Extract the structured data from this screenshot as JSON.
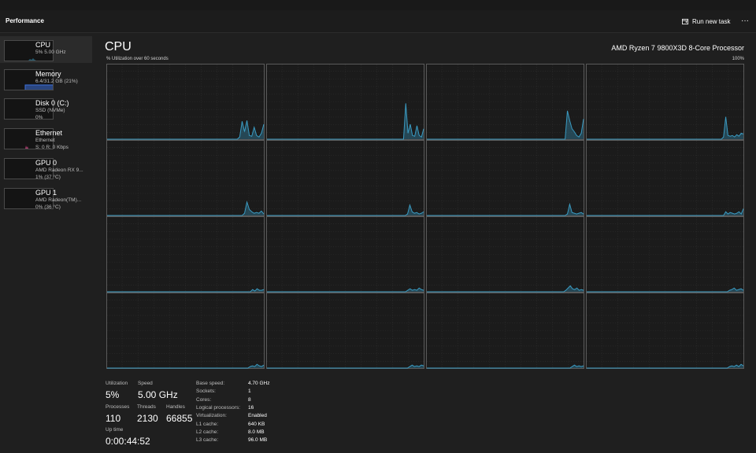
{
  "header": {
    "title": "Performance",
    "run_task_label": "Run new task",
    "more_label": "···"
  },
  "nav": [
    {
      "name": "CPU",
      "sub1": "5%  5.00 GHz",
      "sub2": ""
    },
    {
      "name": "Memory",
      "sub1": "6.4/31.2 GB (21%)",
      "sub2": ""
    },
    {
      "name": "Disk 0 (C:)",
      "sub1": "SSD (NVMe)",
      "sub2": "0%"
    },
    {
      "name": "Ethernet",
      "sub1": "Ethernet",
      "sub2": "S: 0 R: 0 Kbps"
    },
    {
      "name": "GPU 0",
      "sub1": "AMD Radeon RX 9...",
      "sub2": "1% (37 °C)"
    },
    {
      "name": "GPU 1",
      "sub1": "AMD Radeon(TM)...",
      "sub2": "0% (36 °C)"
    }
  ],
  "main": {
    "title": "CPU",
    "processor": "AMD Ryzen 7 9800X3D 8-Core Processor",
    "caption": "% Utilization over 60 seconds",
    "max_label": "100%"
  },
  "colors": {
    "accent": "#3a9bc2",
    "memory": "#3d6fd8",
    "ethernet": "#c4437d"
  },
  "chart_data": {
    "type": "area",
    "y_range": [
      0,
      100
    ],
    "series": [
      {
        "values": [
          0,
          0,
          0,
          0,
          0,
          0,
          0,
          0,
          0,
          0,
          0,
          0,
          0,
          0,
          0,
          0,
          0,
          0,
          0,
          0,
          0,
          0,
          0,
          0,
          0,
          0,
          0,
          0,
          0,
          0,
          0,
          0,
          0,
          0,
          0,
          0,
          0,
          0,
          0,
          0,
          0,
          0,
          0,
          0,
          0,
          0,
          0,
          0,
          0,
          0,
          0,
          0,
          0,
          0,
          0,
          3,
          24,
          10,
          25,
          5,
          4,
          16,
          5,
          3,
          8,
          20
        ]
      },
      {
        "values": [
          0,
          0,
          0,
          0,
          0,
          0,
          0,
          0,
          0,
          0,
          0,
          0,
          0,
          0,
          0,
          0,
          0,
          0,
          0,
          0,
          0,
          0,
          0,
          0,
          0,
          0,
          0,
          0,
          0,
          0,
          0,
          0,
          0,
          0,
          0,
          0,
          0,
          0,
          0,
          0,
          0,
          0,
          0,
          0,
          0,
          0,
          0,
          0,
          0,
          0,
          0,
          0,
          0,
          0,
          0,
          0,
          0,
          0,
          0,
          0,
          0,
          0,
          48,
          8,
          20,
          5,
          4,
          18,
          5,
          3,
          14
        ]
      },
      {
        "values": [
          0,
          0,
          0,
          0,
          0,
          0,
          0,
          0,
          0,
          0,
          0,
          0,
          0,
          0,
          0,
          0,
          0,
          0,
          0,
          0,
          0,
          0,
          0,
          0,
          0,
          0,
          0,
          0,
          0,
          0,
          0,
          0,
          0,
          0,
          0,
          0,
          0,
          0,
          0,
          0,
          0,
          0,
          0,
          0,
          0,
          0,
          0,
          0,
          0,
          0,
          0,
          0,
          0,
          0,
          0,
          0,
          0,
          0,
          0,
          0,
          0,
          38,
          25,
          14,
          10,
          5,
          3,
          8,
          27
        ]
      },
      {
        "values": [
          0,
          0,
          0,
          0,
          0,
          0,
          0,
          0,
          0,
          0,
          0,
          0,
          0,
          0,
          0,
          0,
          0,
          0,
          0,
          0,
          0,
          0,
          0,
          0,
          0,
          0,
          0,
          0,
          0,
          0,
          0,
          0,
          0,
          0,
          0,
          0,
          0,
          0,
          0,
          0,
          0,
          0,
          0,
          0,
          0,
          0,
          0,
          0,
          0,
          0,
          0,
          0,
          0,
          0,
          0,
          0,
          0,
          0,
          0,
          0,
          0,
          0,
          3,
          30,
          5,
          4,
          5,
          3,
          6,
          4,
          8,
          7
        ]
      },
      {
        "values": [
          0,
          0,
          0,
          0,
          0,
          0,
          0,
          0,
          0,
          0,
          0,
          0,
          0,
          0,
          0,
          0,
          0,
          0,
          0,
          0,
          0,
          0,
          0,
          0,
          0,
          0,
          0,
          0,
          0,
          0,
          0,
          0,
          0,
          0,
          0,
          0,
          0,
          0,
          0,
          0,
          0,
          0,
          0,
          0,
          0,
          0,
          0,
          0,
          0,
          0,
          0,
          0,
          0,
          0,
          0,
          0,
          0,
          3,
          18,
          8,
          5,
          3,
          4,
          3,
          6,
          2
        ]
      },
      {
        "values": [
          0,
          0,
          0,
          0,
          0,
          0,
          0,
          0,
          0,
          0,
          0,
          0,
          0,
          0,
          0,
          0,
          0,
          0,
          0,
          0,
          0,
          0,
          0,
          0,
          0,
          0,
          0,
          0,
          0,
          0,
          0,
          0,
          0,
          0,
          0,
          0,
          0,
          0,
          0,
          0,
          0,
          0,
          0,
          0,
          0,
          0,
          0,
          0,
          0,
          0,
          0,
          0,
          0,
          0,
          0,
          0,
          0,
          0,
          0,
          0,
          0,
          2,
          14,
          5,
          3,
          4,
          2,
          3,
          5
        ]
      },
      {
        "values": [
          0,
          0,
          0,
          0,
          0,
          0,
          0,
          0,
          0,
          0,
          0,
          0,
          0,
          0,
          0,
          0,
          0,
          0,
          0,
          0,
          0,
          0,
          0,
          0,
          0,
          0,
          0,
          0,
          0,
          0,
          0,
          0,
          0,
          0,
          0,
          0,
          0,
          0,
          0,
          0,
          0,
          0,
          0,
          0,
          0,
          0,
          0,
          0,
          0,
          0,
          0,
          0,
          0,
          0,
          0,
          0,
          0,
          0,
          0,
          0,
          0,
          2,
          15,
          4,
          3,
          2,
          3,
          4,
          2
        ]
      },
      {
        "values": [
          0,
          0,
          0,
          0,
          0,
          0,
          0,
          0,
          0,
          0,
          0,
          0,
          0,
          0,
          0,
          0,
          0,
          0,
          0,
          0,
          0,
          0,
          0,
          0,
          0,
          0,
          0,
          0,
          0,
          0,
          0,
          0,
          0,
          0,
          0,
          0,
          0,
          0,
          0,
          0,
          0,
          0,
          0,
          0,
          0,
          0,
          0,
          0,
          0,
          0,
          0,
          0,
          0,
          0,
          0,
          0,
          0,
          0,
          0,
          0,
          0,
          0,
          0,
          5,
          2,
          4,
          3,
          2,
          3,
          5,
          2,
          9
        ]
      },
      {
        "values": [
          0,
          0,
          0,
          0,
          0,
          0,
          0,
          0,
          0,
          0,
          0,
          0,
          0,
          0,
          0,
          0,
          0,
          0,
          0,
          0,
          0,
          0,
          0,
          0,
          0,
          0,
          0,
          0,
          0,
          0,
          0,
          0,
          0,
          0,
          0,
          0,
          0,
          0,
          0,
          0,
          0,
          0,
          0,
          0,
          0,
          0,
          0,
          0,
          0,
          0,
          0,
          0,
          0,
          0,
          0,
          0,
          0,
          0,
          0,
          0,
          0,
          0,
          0,
          0,
          0,
          3,
          1,
          4,
          2,
          2,
          3
        ]
      },
      {
        "values": [
          0,
          0,
          0,
          0,
          0,
          0,
          0,
          0,
          0,
          0,
          0,
          0,
          0,
          0,
          0,
          0,
          0,
          0,
          0,
          0,
          0,
          0,
          0,
          0,
          0,
          0,
          0,
          0,
          0,
          0,
          0,
          0,
          0,
          0,
          0,
          0,
          0,
          0,
          0,
          0,
          0,
          0,
          0,
          0,
          0,
          0,
          0,
          0,
          0,
          0,
          0,
          0,
          0,
          0,
          0,
          0,
          0,
          0,
          0,
          0,
          0,
          0,
          2,
          4,
          2,
          3,
          2,
          5,
          3,
          2
        ]
      },
      {
        "values": [
          0,
          0,
          0,
          0,
          0,
          0,
          0,
          0,
          0,
          0,
          0,
          0,
          0,
          0,
          0,
          0,
          0,
          0,
          0,
          0,
          0,
          0,
          0,
          0,
          0,
          0,
          0,
          0,
          0,
          0,
          0,
          0,
          0,
          0,
          0,
          0,
          0,
          0,
          0,
          0,
          0,
          0,
          0,
          0,
          0,
          0,
          0,
          0,
          0,
          0,
          0,
          0,
          0,
          0,
          0,
          0,
          0,
          0,
          0,
          0,
          0,
          0,
          0,
          2,
          5,
          8,
          4,
          3,
          5,
          2,
          3,
          2
        ]
      },
      {
        "values": [
          0,
          0,
          0,
          0,
          0,
          0,
          0,
          0,
          0,
          0,
          0,
          0,
          0,
          0,
          0,
          0,
          0,
          0,
          0,
          0,
          0,
          0,
          0,
          0,
          0,
          0,
          0,
          0,
          0,
          0,
          0,
          0,
          0,
          0,
          0,
          0,
          0,
          0,
          0,
          0,
          0,
          0,
          0,
          0,
          0,
          0,
          0,
          0,
          0,
          0,
          0,
          0,
          0,
          0,
          0,
          0,
          0,
          0,
          0,
          0,
          0,
          0,
          2,
          3,
          5,
          2,
          3,
          4,
          2
        ]
      },
      {
        "values": [
          0,
          0,
          0,
          0,
          0,
          0,
          0,
          0,
          0,
          0,
          0,
          0,
          0,
          0,
          0,
          0,
          0,
          0,
          0,
          0,
          0,
          0,
          0,
          0,
          0,
          0,
          0,
          0,
          0,
          0,
          0,
          0,
          0,
          0,
          0,
          0,
          0,
          0,
          0,
          0,
          0,
          0,
          0,
          0,
          0,
          0,
          0,
          0,
          0,
          0,
          0,
          0,
          0,
          0,
          0,
          0,
          0,
          0,
          0,
          0,
          0,
          0,
          0,
          2,
          3,
          2,
          5,
          3,
          2,
          4
        ]
      },
      {
        "values": [
          0,
          0,
          0,
          0,
          0,
          0,
          0,
          0,
          0,
          0,
          0,
          0,
          0,
          0,
          0,
          0,
          0,
          0,
          0,
          0,
          0,
          0,
          0,
          0,
          0,
          0,
          0,
          0,
          0,
          0,
          0,
          0,
          0,
          0,
          0,
          0,
          0,
          0,
          0,
          0,
          0,
          0,
          0,
          0,
          0,
          0,
          0,
          0,
          0,
          0,
          0,
          0,
          0,
          0,
          0,
          0,
          0,
          0,
          0,
          0,
          0,
          0,
          2,
          4,
          2,
          3,
          2,
          4,
          3
        ]
      },
      {
        "values": [
          0,
          0,
          0,
          0,
          0,
          0,
          0,
          0,
          0,
          0,
          0,
          0,
          0,
          0,
          0,
          0,
          0,
          0,
          0,
          0,
          0,
          0,
          0,
          0,
          0,
          0,
          0,
          0,
          0,
          0,
          0,
          0,
          0,
          0,
          0,
          0,
          0,
          0,
          0,
          0,
          0,
          0,
          0,
          0,
          0,
          0,
          0,
          0,
          0,
          0,
          0,
          0,
          0,
          0,
          0,
          0,
          0,
          0,
          0,
          0,
          0,
          0,
          0,
          0,
          2,
          4,
          2,
          3,
          2,
          3
        ]
      },
      {
        "values": [
          0,
          0,
          0,
          0,
          0,
          0,
          0,
          0,
          0,
          0,
          0,
          0,
          0,
          0,
          0,
          0,
          0,
          0,
          0,
          0,
          0,
          0,
          0,
          0,
          0,
          0,
          0,
          0,
          0,
          0,
          0,
          0,
          0,
          0,
          0,
          0,
          0,
          0,
          0,
          0,
          0,
          0,
          0,
          0,
          0,
          0,
          0,
          0,
          0,
          0,
          0,
          0,
          0,
          0,
          0,
          0,
          0,
          0,
          0,
          0,
          0,
          0,
          2,
          3,
          2,
          4,
          2,
          5,
          3
        ]
      }
    ]
  },
  "stats": {
    "utilization_label": "Utilization",
    "utilization": "5%",
    "speed_label": "Speed",
    "speed": "5.00 GHz",
    "processes_label": "Processes",
    "processes": "110",
    "threads_label": "Threads",
    "threads": "2130",
    "handles_label": "Handles",
    "handles": "66855",
    "uptime_label": "Up time",
    "uptime": "0:00:44:52"
  },
  "specs": [
    {
      "k": "Base speed:",
      "v": "4.70 GHz"
    },
    {
      "k": "Sockets:",
      "v": "1"
    },
    {
      "k": "Cores:",
      "v": "8"
    },
    {
      "k": "Logical processors:",
      "v": "16"
    },
    {
      "k": "Virtualization:",
      "v": "Enabled"
    },
    {
      "k": "L1 cache:",
      "v": "640 KB"
    },
    {
      "k": "L2 cache:",
      "v": "8.0 MB"
    },
    {
      "k": "L3 cache:",
      "v": "96.0 MB"
    }
  ]
}
